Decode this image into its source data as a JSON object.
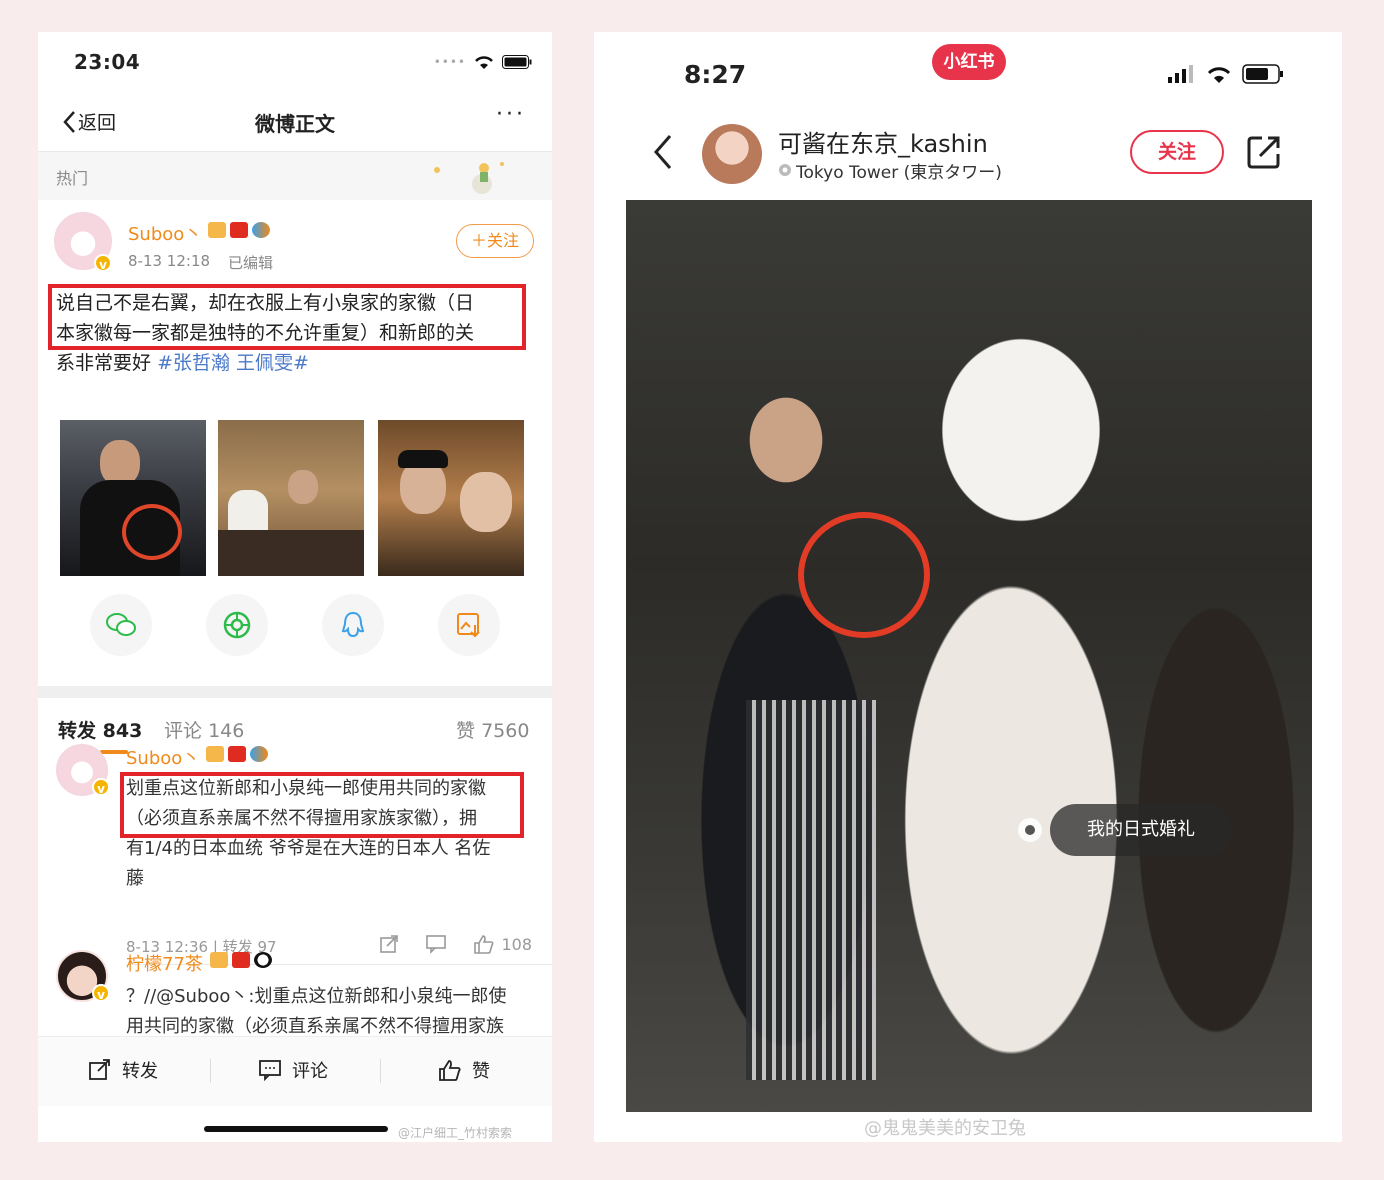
{
  "weibo": {
    "status_time": "23:04",
    "nav": {
      "back_label": "返回",
      "title": "微博正文",
      "more": "···"
    },
    "hot_label": "热门",
    "post": {
      "user_name": "Suboo丶",
      "time": "8-13 12:18",
      "edited": "已编辑",
      "follow_label": "＋关注",
      "text_line1": "说自己不是右翼，却在衣服上有小泉家的家徽（日",
      "text_line2": "本家徽每一家都是独特的不允许重复）和新郎的关",
      "text_line3": "系非常要好",
      "hashtag": "#张哲瀚 王佩雯#"
    },
    "share_icons": [
      "wechat-icon",
      "moments-icon",
      "qq-icon",
      "save-image-icon"
    ],
    "tabs": {
      "repost_label": "转发",
      "repost_count": "843",
      "comment_label": "评论",
      "comment_count": "146",
      "like_label": "赞",
      "like_count": "7560"
    },
    "comments": [
      {
        "user_name": "Suboo丶",
        "line1": "划重点这位新郎和小泉纯一郎使用共同的家徽",
        "line2": "（必须直系亲属不然不得擅用家族家徽），拥",
        "line3": "有1/4的日本血统 爷爷是在大连的日本人 名佐",
        "line4": "藤",
        "time": "8-13 12:36",
        "repost": "转发 97",
        "likes": "108"
      },
      {
        "user_name": "柠檬77茶",
        "line1": "？//@Suboo丶:划重点这位新郎和小泉纯一郎使",
        "line2": "用共同的家徽（必须直系亲属不然不得擅用家族"
      }
    ],
    "bottom": {
      "repost": "转发",
      "comment": "评论",
      "like": "赞"
    },
    "watermark": "@江户细工_竹村索索"
  },
  "xhs": {
    "status_time": "8:27",
    "app_logo": "小红书",
    "author_name": "可酱在东京_kashin",
    "location": "Tokyo Tower (東京タワー)",
    "follow_label": "关注",
    "tag_label": "我的日式婚礼",
    "watermark": "@鬼鬼美美的安卫兔"
  },
  "colors": {
    "weibo_orange": "#f08a1a",
    "highlight_red": "#e2232a",
    "xhs_red": "#e8344a",
    "hashtag_blue": "#4b79c8"
  }
}
